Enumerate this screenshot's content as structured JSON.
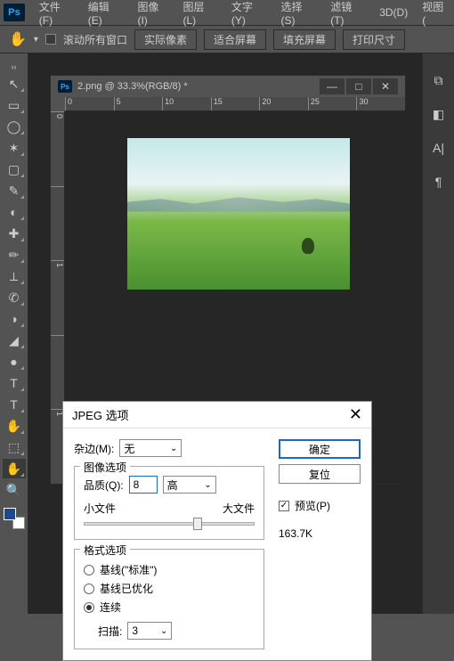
{
  "menubar": {
    "items": [
      "文件(F)",
      "编辑(E)",
      "图像(I)",
      "图层(L)",
      "文字(Y)",
      "选择(S)",
      "滤镜(T)",
      "3D(D)",
      "视图("
    ]
  },
  "optbar": {
    "scroll_all": "滚动所有窗口",
    "actual_pixels": "实际像素",
    "fit_screen": "适合屏幕",
    "fill_screen": "填充屏幕",
    "print_size": "打印尺寸"
  },
  "document": {
    "title": "2.png @ 33.3%(RGB/8) *",
    "h_ticks": [
      "0",
      "5",
      "10",
      "15",
      "20",
      "25",
      "30"
    ],
    "v_ticks": [
      "0",
      "",
      "1",
      "",
      "1"
    ]
  },
  "dialog": {
    "title": "JPEG 选项",
    "matte_label": "杂边(M):",
    "matte_value": "无",
    "image_options": "图像选项",
    "quality_label": "品质(Q):",
    "quality_value": "8",
    "quality_preset": "高",
    "small_file": "小文件",
    "large_file": "大文件",
    "format_options": "格式选项",
    "baseline_std": "基线(\"标准\")",
    "baseline_opt": "基线已优化",
    "progressive": "连续",
    "scans_label": "扫描:",
    "scans_value": "3",
    "ok": "确定",
    "reset": "复位",
    "preview": "预览(P)",
    "filesize": "163.7K"
  },
  "tools": [
    "↖",
    "▭",
    "◯",
    "✶",
    "▢",
    "✎",
    "◐",
    "✚",
    "✏",
    "⟂",
    "✆",
    "◑",
    "◢",
    "●",
    "T",
    "↘",
    "✋",
    "⬚",
    "✋",
    "🔍"
  ]
}
